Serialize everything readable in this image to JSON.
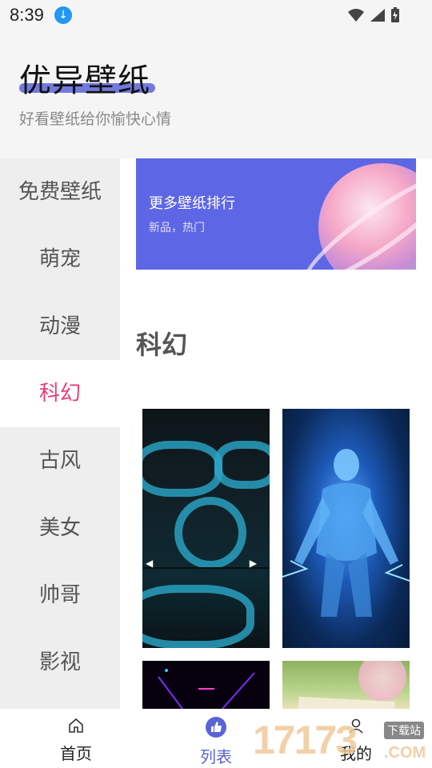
{
  "status": {
    "time": "8:39"
  },
  "header": {
    "title": "优异壁纸",
    "subtitle": "好看壁纸给你愉快心情"
  },
  "sidebar": {
    "items": [
      {
        "label": "免费壁纸"
      },
      {
        "label": "萌宠"
      },
      {
        "label": "动漫"
      },
      {
        "label": "科幻",
        "active": true
      },
      {
        "label": "古风"
      },
      {
        "label": "美女"
      },
      {
        "label": "帅哥"
      },
      {
        "label": "影视"
      }
    ]
  },
  "banner": {
    "title": "更多壁纸排行",
    "subtitle": "新品，热门"
  },
  "section": {
    "title": "科幻"
  },
  "nav": {
    "items": [
      {
        "label": "首页",
        "icon": "home-icon"
      },
      {
        "label": "列表",
        "icon": "thumbs-up-icon",
        "active": true
      },
      {
        "label": "我的",
        "icon": "person-icon"
      }
    ]
  },
  "watermark": {
    "number": "17173",
    "badge": "下载站",
    "domain": ".COM"
  },
  "colors": {
    "accent": "#5b63d8",
    "active_category": "#e83e79",
    "banner": "#5d66e5"
  }
}
